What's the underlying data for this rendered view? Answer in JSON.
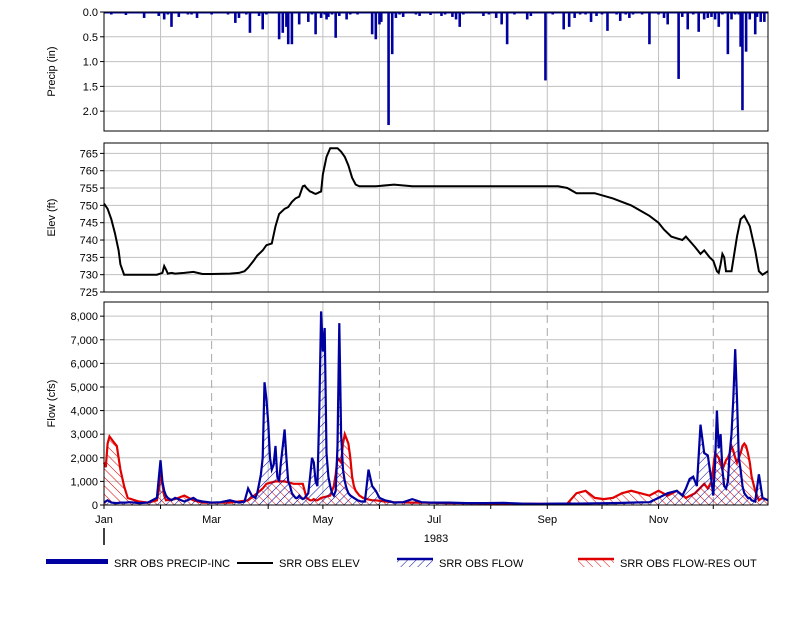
{
  "chart_data": [
    {
      "type": "bar",
      "ylabel": "Precip (in)",
      "inverted_y": true,
      "ylim": [
        0,
        2.4
      ],
      "yticks": [
        "0.0",
        "0.5",
        "1.0",
        "1.5",
        "2.0"
      ],
      "grid": true,
      "color": "#0000a0",
      "series": [
        {
          "name": "SRR OBS PRECIP-INC",
          "day_of_year": [
            5,
            7,
            9,
            11,
            13,
            15,
            17,
            18,
            23,
            25,
            29,
            31,
            34,
            36,
            38,
            42,
            47,
            49,
            52,
            56,
            58,
            60,
            63,
            68,
            69,
            73,
            75,
            79,
            81,
            84,
            86,
            88,
            90,
            92,
            94,
            97,
            99,
            101,
            102,
            104,
            106,
            108,
            113,
            115,
            117,
            120,
            122,
            123,
            124,
            126,
            128,
            130,
            132,
            134,
            136,
            138,
            140,
            144,
            146,
            148,
            150,
            152,
            153,
            157,
            159,
            161,
            163,
            165,
            172,
            174,
            176,
            178,
            180,
            182,
            186,
            188,
            192,
            194,
            196,
            198,
            200,
            207,
            209,
            212,
            216,
            219,
            222,
            226,
            233,
            235,
            240,
            243,
            247,
            251,
            253,
            256,
            259,
            262,
            265,
            268,
            271,
            274,
            277,
            279,
            282,
            284,
            287,
            289,
            291,
            293,
            296,
            298,
            300,
            303,
            305,
            308,
            310,
            312,
            316,
            318,
            321,
            324,
            326,
            327,
            330,
            332,
            334,
            336,
            338,
            340,
            343,
            345,
            347,
            349,
            350,
            351,
            353,
            355,
            358,
            359,
            361,
            363
          ],
          "values": [
            0.05,
            0.02,
            0.03,
            0.02,
            0.06,
            0.03,
            0.02,
            0.02,
            0.12,
            0.03,
            0.02,
            0.08,
            0.15,
            0.05,
            0.3,
            0.1,
            0.05,
            0.05,
            0.12,
            0.03,
            0.02,
            0.05,
            0.02,
            0.03,
            0.05,
            0.22,
            0.12,
            0.05,
            0.42,
            0.03,
            0.08,
            0.35,
            0.05,
            0.02,
            0.03,
            0.55,
            0.42,
            0.3,
            0.65,
            0.65,
            0.02,
            0.25,
            0.2,
            0.05,
            0.45,
            0.12,
            0.05,
            0.15,
            0.1,
            0.05,
            0.52,
            0.08,
            0.03,
            0.15,
            0.05,
            0.02,
            0.05,
            0.02,
            0.02,
            0.45,
            0.55,
            0.25,
            0.2,
            2.28,
            0.85,
            0.12,
            0.05,
            0.1,
            0.05,
            0.08,
            0.03,
            0.02,
            0.06,
            0.02,
            0.08,
            0.05,
            0.1,
            0.15,
            0.3,
            0.05,
            0.02,
            0.03,
            0.08,
            0.05,
            0.12,
            0.25,
            0.65,
            0.05,
            0.15,
            0.08,
            0.02,
            1.38,
            0.05,
            0.03,
            0.35,
            0.3,
            0.12,
            0.05,
            0.05,
            0.2,
            0.08,
            0.05,
            0.38,
            0.02,
            0.05,
            0.18,
            0.05,
            0.12,
            0.05,
            0.03,
            0.05,
            0.02,
            0.65,
            0.02,
            0.05,
            0.12,
            0.25,
            0.02,
            1.35,
            0.1,
            0.35,
            0.05,
            0.02,
            0.4,
            0.15,
            0.12,
            0.1,
            0.15,
            0.3,
            0.05,
            0.85,
            0.15,
            0.05,
            0.05,
            0.7,
            1.98,
            0.8,
            0.15,
            0.45,
            0.1,
            0.2,
            0.2,
            0.08,
            0.05,
            0.65,
            0.35
          ],
          "values_note_removed": true
        }
      ]
    },
    {
      "type": "line",
      "ylabel": "Elev (ft)",
      "ylim": [
        725,
        768
      ],
      "yticks": [
        "725",
        "730",
        "735",
        "740",
        "745",
        "750",
        "755",
        "760",
        "765"
      ],
      "grid": true,
      "series": [
        {
          "name": "SRR OBS ELEV",
          "color": "#000000",
          "day_of_year": [
            1,
            3,
            5,
            7,
            9,
            10,
            12,
            20,
            30,
            33,
            34,
            35,
            36,
            38,
            40,
            45,
            50,
            55,
            60,
            70,
            75,
            78,
            80,
            83,
            85,
            88,
            90,
            93,
            95,
            97,
            100,
            102,
            104,
            106,
            108,
            109,
            110,
            111,
            112,
            113,
            114,
            115,
            116,
            117,
            118,
            119,
            120,
            121,
            123,
            125,
            127,
            129,
            131,
            133,
            135,
            137,
            139,
            141,
            143,
            145,
            147,
            150,
            160,
            170,
            180,
            200,
            220,
            240,
            250,
            255,
            260,
            265,
            270,
            280,
            290,
            300,
            305,
            308,
            310,
            312,
            315,
            318,
            320,
            325,
            328,
            330,
            333,
            335,
            337,
            338,
            339,
            340,
            341,
            342,
            345,
            348,
            350,
            352,
            355,
            358,
            360,
            362,
            365
          ],
          "values": [
            750.5,
            749,
            746,
            742,
            737,
            733,
            730,
            730,
            730,
            730.5,
            732.5,
            731.5,
            730.3,
            730.5,
            730.3,
            730.5,
            730.8,
            730.2,
            730.2,
            730.3,
            730.5,
            731,
            732,
            734,
            735.5,
            737,
            738.5,
            739,
            744,
            747.5,
            749,
            749.5,
            751,
            752,
            752.5,
            754,
            755.5,
            755.7,
            755,
            754.5,
            754,
            753.8,
            753.5,
            753.3,
            753.5,
            753.8,
            754,
            759,
            764,
            766.5,
            766.5,
            766.5,
            765.5,
            764,
            761.5,
            758,
            756,
            755.5,
            755.5,
            755.5,
            755.5,
            755.5,
            756,
            755.5,
            755.5,
            755.5,
            755.5,
            755.5,
            755.5,
            755,
            753.5,
            753.5,
            753.5,
            752,
            750,
            747,
            745,
            743,
            742,
            741,
            740.5,
            740,
            741,
            738,
            736,
            737,
            735,
            734,
            731,
            730.5,
            733,
            736,
            735,
            731,
            731,
            741,
            746,
            747,
            744,
            737,
            731,
            730,
            731,
            730.5,
            730.2
          ],
          "values_note_removed": true
        }
      ]
    },
    {
      "type": "area",
      "ylabel": "Flow (cfs)",
      "ylim": [
        0,
        8600
      ],
      "yticks": [
        "0",
        "1,000",
        "2,000",
        "3,000",
        "4,000",
        "5,000",
        "6,000",
        "7,000",
        "8,000"
      ],
      "xlabel": "1983",
      "x_ticks": [
        "Jan",
        "Mar",
        "May",
        "Jul",
        "Sep",
        "Nov"
      ],
      "grid": true,
      "series": [
        {
          "name": "SRR OBS FLOW",
          "color": "#0000a0",
          "day_of_year": [
            1,
            3,
            5,
            8,
            10,
            13,
            15,
            18,
            20,
            25,
            30,
            32,
            33,
            34,
            35,
            36,
            38,
            40,
            45,
            50,
            52,
            55,
            60,
            65,
            70,
            75,
            78,
            80,
            82,
            84,
            85,
            86,
            87,
            88,
            89,
            90,
            91,
            92,
            93,
            94,
            95,
            96,
            97,
            98,
            99,
            100,
            101,
            102,
            103,
            104,
            105,
            106,
            107,
            108,
            109,
            110,
            111,
            112,
            113,
            114,
            115,
            116,
            117,
            118,
            119,
            120,
            121,
            122,
            123,
            124,
            125,
            126,
            127,
            128,
            129,
            130,
            131,
            132,
            133,
            134,
            135,
            136,
            137,
            138,
            139,
            140,
            142,
            144,
            146,
            148,
            150,
            152,
            155,
            158,
            160,
            165,
            170,
            175,
            180,
            190,
            200,
            210,
            220,
            230,
            240,
            250,
            260,
            270,
            280,
            290,
            300,
            305,
            310,
            315,
            318,
            320,
            322,
            324,
            326,
            328,
            330,
            332,
            334,
            335,
            336,
            337,
            338,
            339,
            340,
            341,
            342,
            343,
            344,
            345,
            346,
            347,
            348,
            349,
            350,
            351,
            352,
            353,
            354,
            355,
            356,
            358,
            360,
            362,
            365
          ],
          "values": [
            100,
            200,
            100,
            80,
            100,
            100,
            120,
            100,
            80,
            100,
            300,
            1900,
            1000,
            600,
            400,
            300,
            200,
            300,
            150,
            300,
            200,
            150,
            100,
            120,
            200,
            100,
            150,
            700,
            400,
            300,
            500,
            900,
            1300,
            2000,
            5200,
            4500,
            3500,
            2000,
            1500,
            1700,
            2500,
            1200,
            1000,
            1800,
            2500,
            3200,
            2000,
            1000,
            800,
            500,
            400,
            300,
            300,
            400,
            300,
            250,
            300,
            400,
            500,
            1200,
            2000,
            1800,
            1000,
            800,
            4000,
            8200,
            6500,
            7500,
            2200,
            1200,
            800,
            500,
            400,
            600,
            2500,
            7700,
            3000,
            1500,
            1000,
            700,
            500,
            400,
            350,
            300,
            250,
            200,
            150,
            150,
            1500,
            800,
            600,
            300,
            200,
            150,
            100,
            120,
            250,
            120,
            100,
            100,
            80,
            80,
            90,
            60,
            50,
            60,
            60,
            70,
            80,
            100,
            120,
            300,
            500,
            600,
            400,
            700,
            1100,
            1200,
            800,
            3400,
            2200,
            2100,
            1000,
            400,
            1800,
            4000,
            2400,
            3000,
            1500,
            800,
            700,
            1000,
            2200,
            3000,
            4500,
            6600,
            4500,
            2000,
            1500,
            800,
            500,
            400,
            300,
            300,
            200,
            150,
            1300,
            300,
            200,
            150
          ],
          "values_note_removed": true
        },
        {
          "name": "SRR OBS FLOW-RES OUT",
          "color": "#e00000",
          "day_of_year": [
            1,
            2,
            3,
            4,
            6,
            8,
            10,
            12,
            14,
            20,
            25,
            30,
            31,
            32,
            33,
            34,
            35,
            40,
            45,
            50,
            55,
            60,
            70,
            80,
            85,
            88,
            90,
            95,
            100,
            105,
            110,
            112,
            113,
            114,
            115,
            116,
            117,
            118,
            120,
            125,
            127,
            128,
            129,
            130,
            131,
            132,
            133,
            134,
            135,
            136,
            137,
            138,
            139,
            140,
            141,
            142,
            143,
            144,
            145,
            148,
            150,
            155,
            160,
            170,
            180,
            190,
            200,
            220,
            240,
            250,
            255,
            260,
            265,
            270,
            275,
            280,
            285,
            290,
            295,
            300,
            305,
            310,
            315,
            320,
            325,
            330,
            332,
            334,
            336,
            338,
            340,
            342,
            343,
            344,
            345,
            346,
            347,
            348,
            349,
            350,
            351,
            352,
            353,
            354,
            355,
            356,
            358,
            360,
            362,
            365
          ],
          "values": [
            1800,
            1600,
            2600,
            2900,
            2700,
            2500,
            1500,
            800,
            300,
            150,
            100,
            200,
            600,
            1400,
            900,
            400,
            200,
            250,
            400,
            200,
            100,
            100,
            100,
            200,
            500,
            700,
            900,
            1000,
            1000,
            900,
            900,
            300,
            250,
            200,
            200,
            250,
            200,
            200,
            300,
            400,
            800,
            1300,
            2000,
            1900,
            1800,
            2600,
            3000,
            2800,
            2600,
            2000,
            1200,
            800,
            600,
            500,
            400,
            350,
            300,
            300,
            250,
            200,
            200,
            150,
            120,
            100,
            100,
            80,
            80,
            60,
            50,
            50,
            60,
            500,
            600,
            300,
            250,
            300,
            500,
            600,
            500,
            400,
            600,
            400,
            600,
            300,
            500,
            900,
            700,
            1000,
            2200,
            2000,
            1500,
            1900,
            2000,
            2200,
            2500,
            2300,
            2000,
            1800,
            2000,
            2200,
            2500,
            2600,
            2500,
            2200,
            1800,
            1200,
            600,
            200,
            300,
            200
          ],
          "values_note_removed": true
        }
      ]
    }
  ],
  "legend": [
    {
      "label": "SRR OBS PRECIP-INC",
      "color": "#0000a0",
      "style": "thick"
    },
    {
      "label": "SRR OBS ELEV",
      "color": "#000000",
      "style": "line"
    },
    {
      "label": "SRR OBS FLOW",
      "color": "#0000a0",
      "style": "hatch"
    },
    {
      "label": "SRR OBS FLOW-RES OUT",
      "color": "#e00000",
      "style": "hatch"
    }
  ]
}
